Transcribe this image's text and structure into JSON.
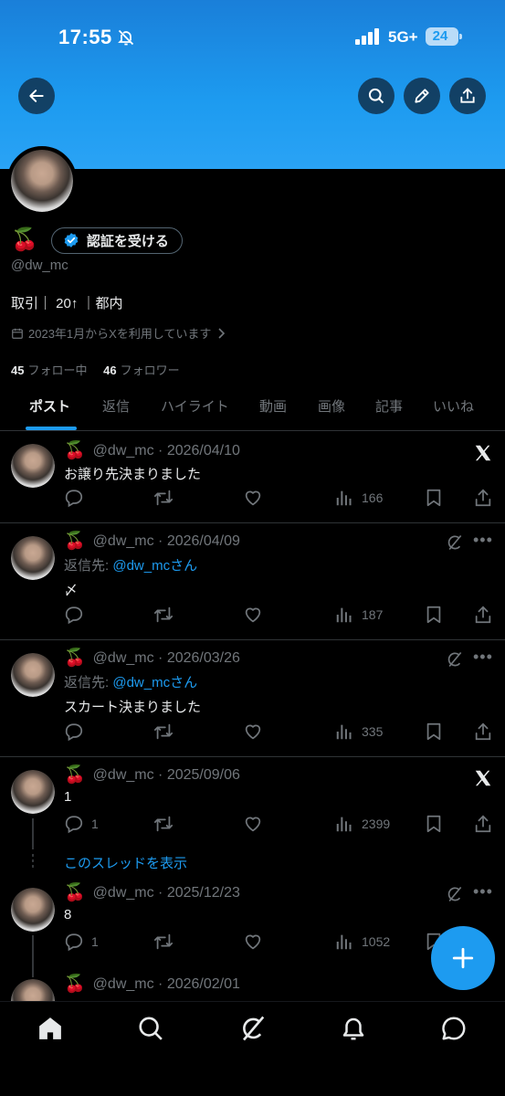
{
  "status_bar": {
    "time": "17:55",
    "network": "5G+",
    "battery": "24"
  },
  "profile": {
    "name_emoji": "🍒",
    "verify_label": "認証を受ける",
    "handle": "@dw_mc",
    "bio": "取引｜ 20↑ ｜都内",
    "joined": "2023年1月からXを利用しています",
    "following_count": "45",
    "following_label": "フォロー中",
    "followers_count": "46",
    "followers_label": "フォロワー"
  },
  "tabs": [
    {
      "label": "ポスト",
      "active": true
    },
    {
      "label": "返信"
    },
    {
      "label": "ハイライト"
    },
    {
      "label": "動画"
    },
    {
      "label": "画像"
    },
    {
      "label": "記事"
    },
    {
      "label": "いいね"
    }
  ],
  "posts": [
    {
      "name_emoji": "🍒",
      "meta": "@dw_mc · 2026/04/10",
      "text": "お譲り先決まりました",
      "views": "166",
      "corner_icon": "x-logo-icon"
    },
    {
      "name_emoji": "🍒",
      "meta": "@dw_mc · 2026/04/09",
      "reply_prefix": "返信先: ",
      "reply_to": "@dw_mcさん",
      "text": "〆",
      "views": "187",
      "corner_icon": "grok-icon"
    },
    {
      "name_emoji": "🍒",
      "meta": "@dw_mc · 2026/03/26",
      "reply_prefix": "返信先: ",
      "reply_to": "@dw_mcさん",
      "text": "スカート決まりました",
      "views": "335",
      "corner_icon": "grok-icon"
    },
    {
      "name_emoji": "🍒",
      "meta": "@dw_mc · 2025/09/06",
      "text": "1",
      "replies": "1",
      "views": "2399",
      "corner_icon": "x-logo-icon"
    },
    {
      "name_emoji": "🍒",
      "meta": "@dw_mc · 2025/12/23",
      "text": "8",
      "replies": "1",
      "views": "1052",
      "corner_icon": "grok-icon"
    },
    {
      "name_emoji": "🍒",
      "meta": "@dw_mc · 2026/02/01"
    }
  ],
  "show_thread_label": "このスレッドを表示",
  "colors": {
    "accent": "#1d9bf0",
    "background": "#000000",
    "muted": "#71767b",
    "divider": "#2f3336"
  }
}
